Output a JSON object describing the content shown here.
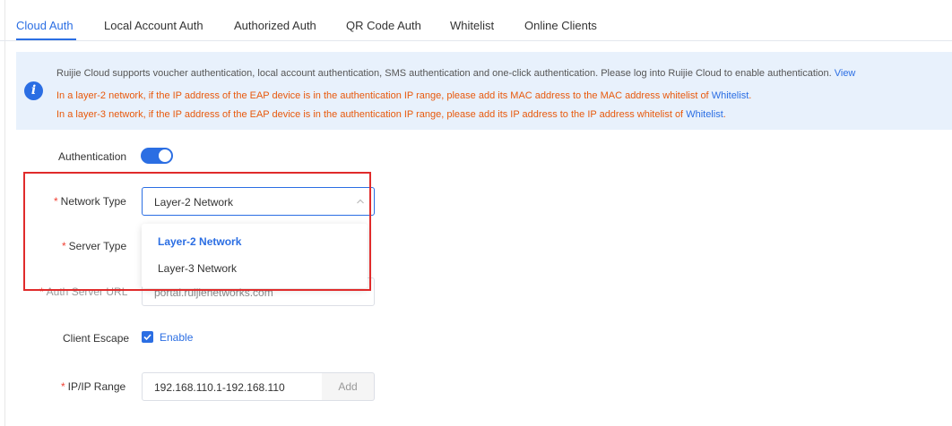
{
  "tabs": [
    {
      "label": "Cloud Auth",
      "active": true
    },
    {
      "label": "Local Account Auth",
      "active": false
    },
    {
      "label": "Authorized Auth",
      "active": false
    },
    {
      "label": "QR Code Auth",
      "active": false
    },
    {
      "label": "Whitelist",
      "active": false
    },
    {
      "label": "Online Clients",
      "active": false
    }
  ],
  "banner": {
    "icon": "info-icon",
    "line1": "Ruijie Cloud supports voucher authentication, local account authentication, SMS authentication and one-click authentication. Please log into Ruijie Cloud to enable authentication.",
    "line1_link": "View",
    "line2_prefix": "In a layer-2 network, if the IP address of the EAP device is in the authentication IP range, please add its MAC address to the MAC address whitelist of",
    "line2_link": "Whitelist",
    "line2_suffix": ".",
    "line3_prefix": "In a layer-3 network, if the IP address of the EAP device is in the authentication IP range, please add its IP address to the IP address whitelist of",
    "line3_link": "Whitelist",
    "line3_suffix": ".",
    "warning_color": "#e8590c"
  },
  "form": {
    "required_mark": "*",
    "authentication": {
      "label": "Authentication",
      "enabled": true
    },
    "network_type": {
      "label": "Network Type",
      "value": "Layer-2 Network",
      "options": [
        "Layer-2 Network",
        "Layer-3 Network"
      ],
      "selected_index": 0
    },
    "server_type": {
      "label": "Server Type"
    },
    "auth_server_url": {
      "label": "Auth Server URL",
      "value": "portal.ruijienetworks.com"
    },
    "client_escape": {
      "label": "Client Escape",
      "checked": true,
      "checkbox_label": "Enable"
    },
    "ip_range": {
      "label": "IP/IP Range",
      "value": "192.168.110.1-192.168.110",
      "add_label": "Add"
    }
  },
  "colors": {
    "accent": "#2b6ee3",
    "required": "#f04134",
    "highlight": "#e02b2b"
  }
}
